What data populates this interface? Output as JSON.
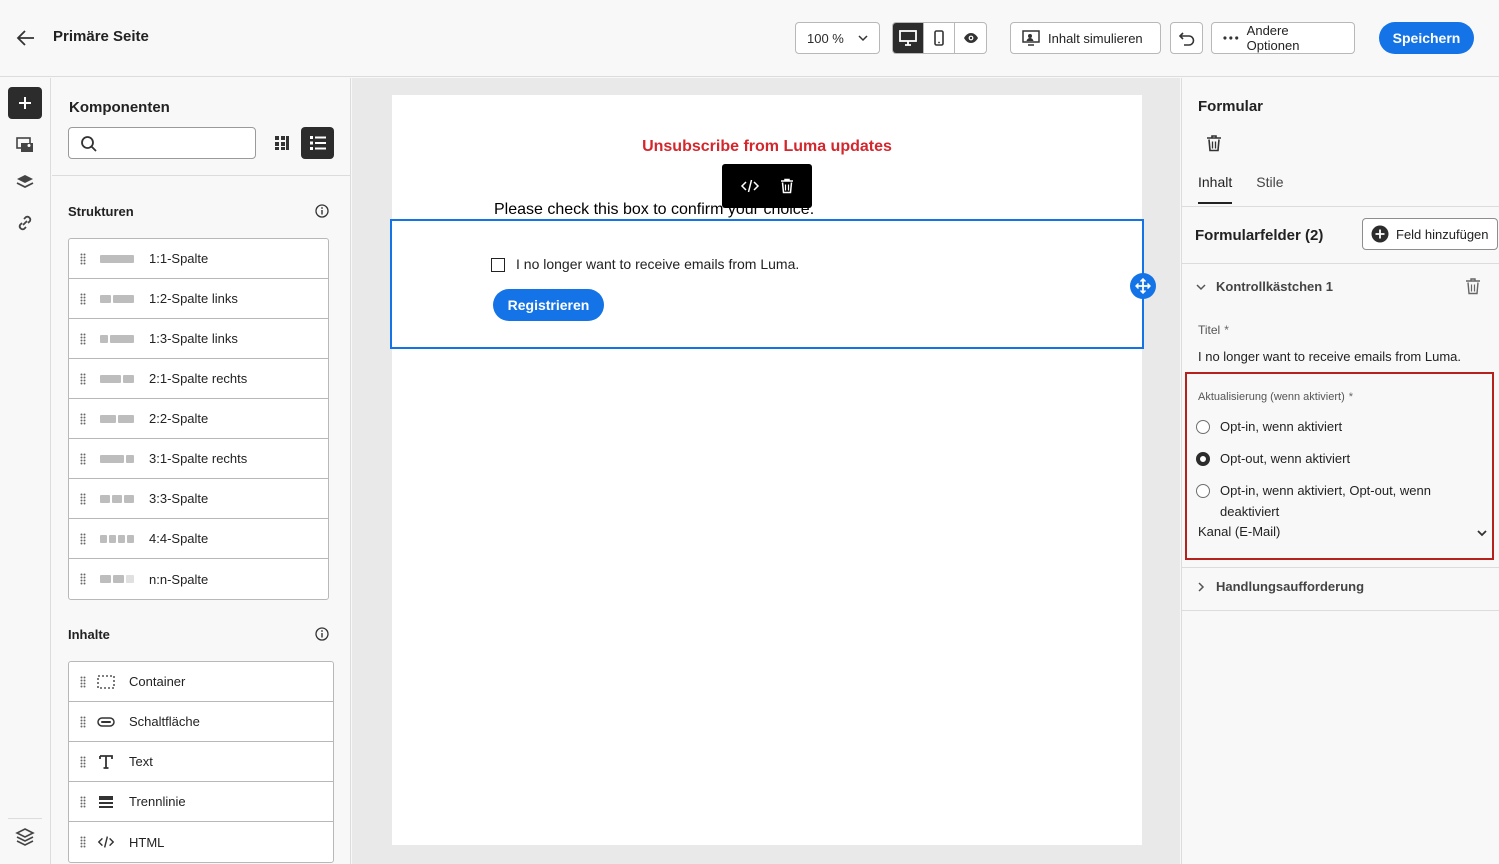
{
  "header": {
    "page_title": "Primäre Seite",
    "zoom_value": "100 %",
    "simulate_label": "Inhalt simulieren",
    "more_label": "Andere Optionen",
    "save_label": "Speichern"
  },
  "components_panel": {
    "title": "Komponenten",
    "search_placeholder": "",
    "structures_heading": "Strukturen",
    "structures": [
      {
        "label": "1:1-Spalte"
      },
      {
        "label": "1:2-Spalte links"
      },
      {
        "label": "1:3-Spalte links"
      },
      {
        "label": "2:1-Spalte rechts"
      },
      {
        "label": "2:2-Spalte"
      },
      {
        "label": "3:1-Spalte rechts"
      },
      {
        "label": "3:3-Spalte"
      },
      {
        "label": "4:4-Spalte"
      },
      {
        "label": "n:n-Spalte"
      }
    ],
    "contents_heading": "Inhalte",
    "contents": [
      {
        "label": "Container",
        "icon": "container-icon"
      },
      {
        "label": "Schaltfläche",
        "icon": "button-icon"
      },
      {
        "label": "Text",
        "icon": "text-icon"
      },
      {
        "label": "Trennlinie",
        "icon": "divider-icon"
      },
      {
        "label": "HTML",
        "icon": "html-icon"
      }
    ]
  },
  "canvas": {
    "email_title": "Unsubscribe from Luma updates",
    "email_text": "Please check this box to confirm your choice.",
    "checkbox_label": "I no longer want to receive emails from Luma.",
    "register_button": "Registrieren"
  },
  "properties_panel": {
    "title": "Formular",
    "tabs": [
      {
        "label": "Inhalt"
      },
      {
        "label": "Stile"
      }
    ],
    "fields_heading": "Formularfelder (2)",
    "add_field_label": "Feld hinzufügen",
    "accordion_title": "Kontrollkästchen 1",
    "title_field_label": "Titel",
    "title_field_value": "I no longer want to receive emails from Luma.",
    "update_label": "Aktualisierung (wenn aktiviert)",
    "required_mark": "*",
    "radio_options": [
      {
        "label": "Opt-in, wenn aktiviert",
        "checked": false
      },
      {
        "label": "Opt-out, wenn aktiviert",
        "checked": true
      },
      {
        "label": "Opt-in, wenn aktiviert, Opt-out, wenn deaktiviert",
        "checked": false
      }
    ],
    "channel_value": "Kanal (E-Mail)",
    "cta_accordion": "Handlungsaufforderung"
  },
  "colors": {
    "accent": "#1473e6",
    "title_red": "#d3272e",
    "highlight_red": "#b5221e",
    "dark": "#2c2c2c"
  }
}
